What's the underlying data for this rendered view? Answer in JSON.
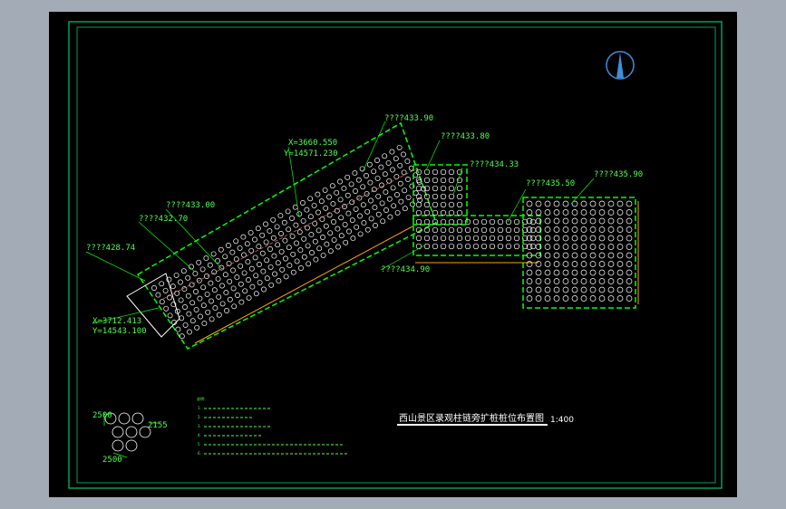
{
  "elevations": {
    "e1": "????433.90",
    "e2": "????433.80",
    "e3": "????434.33",
    "e4": "????435.50",
    "e5": "????435.90",
    "e6": "????433.00",
    "e7": "????432.70",
    "e8": "????428.74",
    "e9": "????434.90"
  },
  "coords": {
    "top_x": "X=3660.550",
    "top_y": "Y=14571.230",
    "bottom_x": "X=3712.413",
    "bottom_y": "Y=14543.100"
  },
  "detail": {
    "dim_a": "2500",
    "dim_b": "2155",
    "dim_c": "2500"
  },
  "title_block": {
    "title": "西山景区录观柱链旁扩桩桩位布置图",
    "scale": "1:400"
  },
  "notes": {
    "heading": "说明:",
    "items": [
      "1.",
      "2.",
      "3.",
      "4.",
      "5.",
      "6."
    ]
  },
  "colors": {
    "background": "#000000",
    "frame": "#00a060",
    "pile_outline": "#00ff00",
    "dimension": "#ffa500",
    "pile": "#ffffff"
  },
  "icons": [
    "north-arrow-icon"
  ]
}
